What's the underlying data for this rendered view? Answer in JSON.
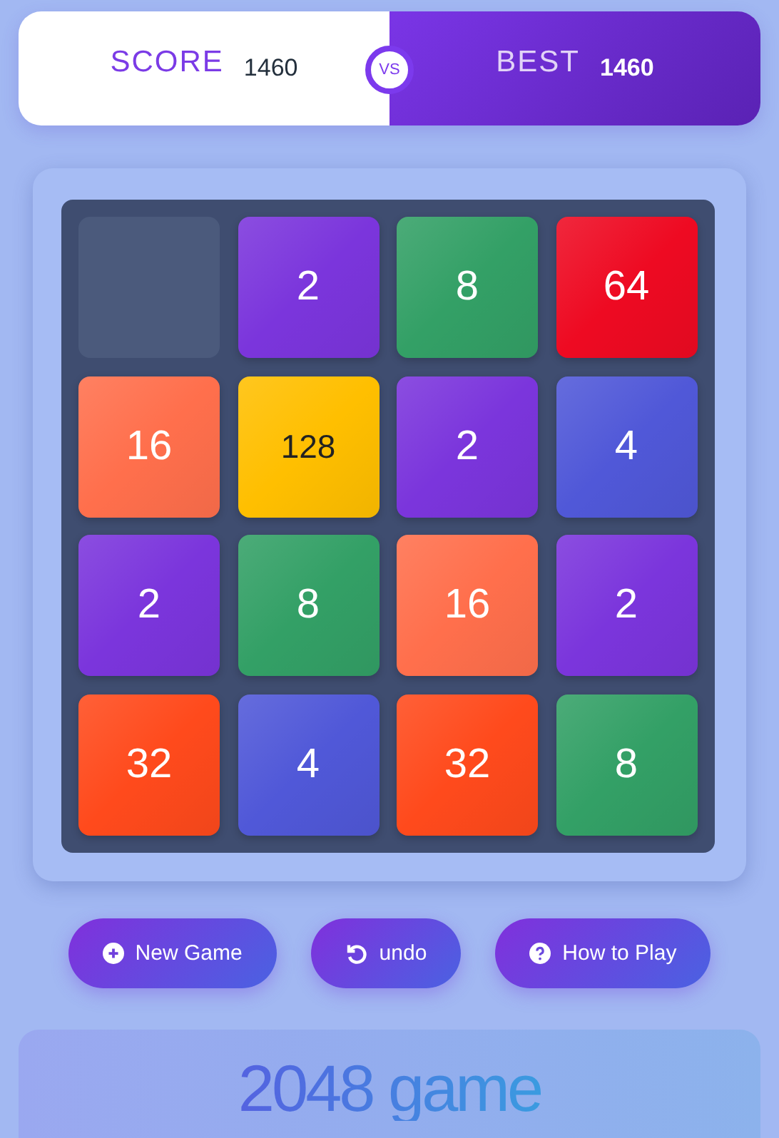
{
  "score": {
    "label": "SCORE",
    "value": "1460"
  },
  "versus": "VS",
  "best": {
    "label": "BEST",
    "value": "1460"
  },
  "tiles": [
    {
      "kind": "empty"
    },
    {
      "kind": "tile",
      "value": "2",
      "color": "#7b35dc"
    },
    {
      "kind": "tile",
      "value": "8",
      "color": "#33a066"
    },
    {
      "kind": "tile",
      "value": "64",
      "color": "#ee0a22"
    },
    {
      "kind": "tile",
      "value": "16",
      "color": "#ff6f4c"
    },
    {
      "kind": "tile",
      "value": "128",
      "color": "#ffbf00"
    },
    {
      "kind": "tile",
      "value": "2",
      "color": "#7b35dc"
    },
    {
      "kind": "tile",
      "value": "4",
      "color": "#5058d8"
    },
    {
      "kind": "tile",
      "value": "2",
      "color": "#7b35dc"
    },
    {
      "kind": "tile",
      "value": "8",
      "color": "#33a066"
    },
    {
      "kind": "tile",
      "value": "16",
      "color": "#ff6f4c"
    },
    {
      "kind": "tile",
      "value": "2",
      "color": "#7b35dc"
    },
    {
      "kind": "tile",
      "value": "32",
      "color": "#ff4a1c"
    },
    {
      "kind": "tile",
      "value": "4",
      "color": "#5058d8"
    },
    {
      "kind": "tile",
      "value": "32",
      "color": "#ff4a1c"
    },
    {
      "kind": "tile",
      "value": "8",
      "color": "#33a066"
    }
  ],
  "buttons": [
    {
      "kind": "new",
      "label": "New Game"
    },
    {
      "kind": "undo",
      "label": "undo"
    },
    {
      "kind": "help",
      "label": "How to Play"
    }
  ],
  "title": "2048 game"
}
